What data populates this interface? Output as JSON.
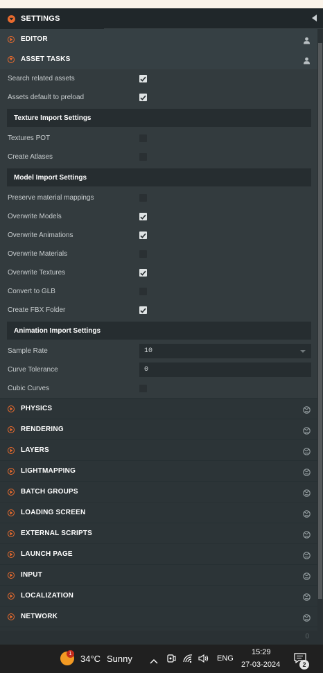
{
  "header": {
    "title": "SETTINGS"
  },
  "sections_top": [
    {
      "label": "EDITOR",
      "icon": "user-icon",
      "expanded": false
    },
    {
      "label": "ASSET TASKS",
      "icon": "user-icon",
      "expanded": true
    }
  ],
  "asset_tasks": {
    "rows_a": [
      {
        "label": "Search related assets",
        "checked": true
      },
      {
        "label": "Assets default to preload",
        "checked": true
      }
    ],
    "texture_header": "Texture Import Settings",
    "rows_b": [
      {
        "label": "Textures POT",
        "checked": false
      },
      {
        "label": "Create Atlases",
        "checked": false
      }
    ],
    "model_header": "Model Import Settings",
    "rows_c": [
      {
        "label": "Preserve material mappings",
        "checked": false
      },
      {
        "label": "Overwrite Models",
        "checked": true
      },
      {
        "label": "Overwrite Animations",
        "checked": true
      },
      {
        "label": "Overwrite Materials",
        "checked": false
      },
      {
        "label": "Overwrite Textures",
        "checked": true
      },
      {
        "label": "Convert to GLB",
        "checked": false
      },
      {
        "label": "Create FBX Folder",
        "checked": true
      }
    ],
    "animation_header": "Animation Import Settings",
    "sample_rate": {
      "label": "Sample Rate",
      "value": "10"
    },
    "curve_tolerance": {
      "label": "Curve Tolerance",
      "value": "0"
    },
    "cubic_curves": {
      "label": "Cubic Curves",
      "checked": false
    }
  },
  "sections_bottom": [
    {
      "label": "PHYSICS",
      "icon": "globe-icon"
    },
    {
      "label": "RENDERING",
      "icon": "globe-icon"
    },
    {
      "label": "LAYERS",
      "icon": "globe-icon"
    },
    {
      "label": "LIGHTMAPPING",
      "icon": "globe-icon"
    },
    {
      "label": "BATCH GROUPS",
      "icon": "globe-icon"
    },
    {
      "label": "LOADING SCREEN",
      "icon": "globe-icon"
    },
    {
      "label": "EXTERNAL SCRIPTS",
      "icon": "globe-icon"
    },
    {
      "label": "LAUNCH PAGE",
      "icon": "globe-icon"
    },
    {
      "label": "INPUT",
      "icon": "globe-icon"
    },
    {
      "label": "LOCALIZATION",
      "icon": "globe-icon"
    },
    {
      "label": "NETWORK",
      "icon": "globe-icon"
    }
  ],
  "footer": {
    "count": "0"
  },
  "taskbar": {
    "weather_badge": "1",
    "temperature": "34°C",
    "condition": "Sunny",
    "language": "ENG",
    "time": "15:29",
    "date": "27-03-2024",
    "notification_count": "2"
  },
  "colors": {
    "accent": "#e96b2e",
    "panel": "#333b3e",
    "header": "#20272a"
  }
}
